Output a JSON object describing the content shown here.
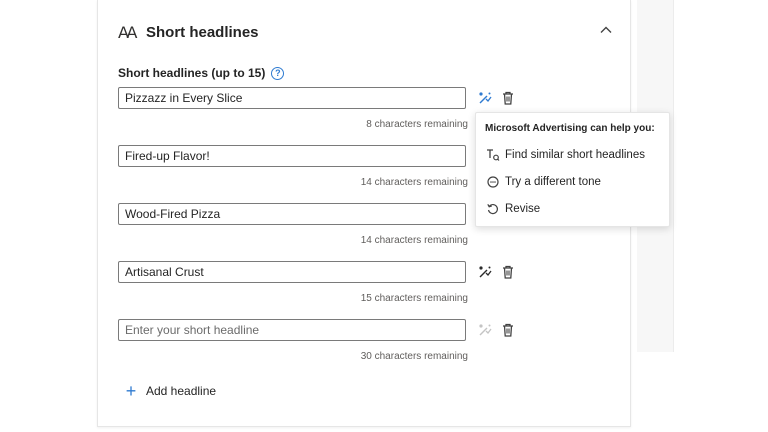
{
  "section": {
    "title": "Short headlines",
    "field_label": "Short headlines (up to 15)"
  },
  "headlines": [
    {
      "value": "Pizzazz in Every Slice",
      "remaining": "8 characters remaining"
    },
    {
      "value": "Fired-up Flavor!",
      "remaining": "14 characters remaining"
    },
    {
      "value": "Wood-Fired Pizza",
      "remaining": "14 characters remaining"
    },
    {
      "value": "Artisanal Crust",
      "remaining": "15 characters remaining"
    },
    {
      "value": "",
      "placeholder": "Enter your short headline",
      "remaining": "30 characters remaining"
    }
  ],
  "add_label": "Add headline",
  "popover": {
    "title": "Microsoft Advertising can help you:",
    "items": [
      {
        "label": "Find similar short headlines",
        "icon": "text-find-icon"
      },
      {
        "label": "Try a different tone",
        "icon": "tone-icon"
      },
      {
        "label": "Revise",
        "icon": "revise-icon"
      }
    ]
  },
  "colors": {
    "accent": "#2f7bd1",
    "border": "#7a7a7a",
    "muted_text": "#605e5c"
  }
}
